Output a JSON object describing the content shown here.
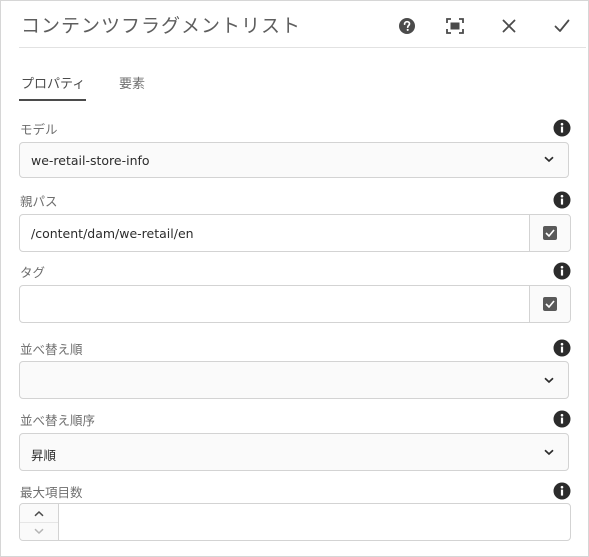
{
  "header": {
    "title": "コンテンツフラグメントリスト",
    "icons": [
      "help-icon",
      "fullscreen-icon",
      "close-icon",
      "done-icon"
    ]
  },
  "tabs": [
    {
      "label": "プロパティ",
      "active": true
    },
    {
      "label": "要素",
      "active": false
    }
  ],
  "fields": {
    "model": {
      "label": "モデル",
      "value": "we-retail-store-info"
    },
    "parent_path": {
      "label": "親パス",
      "value": "/content/dam/we-retail/en",
      "checked": true
    },
    "tags": {
      "label": "タグ",
      "value": "",
      "checked": true
    },
    "order_by": {
      "label": "並べ替え順",
      "value": ""
    },
    "sort_order": {
      "label": "並べ替え順序",
      "value": "昇順"
    },
    "max_items": {
      "label": "最大項目数",
      "value": ""
    }
  },
  "colors": {
    "accent": "#4b4b4b",
    "border": "#d3d3d3",
    "field_bg": "#fafafa"
  }
}
